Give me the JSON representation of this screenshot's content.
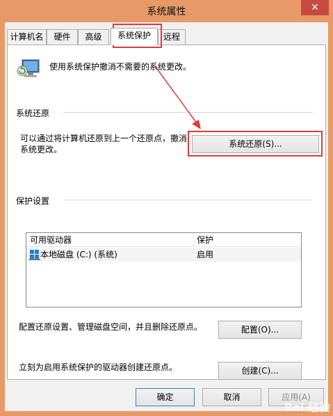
{
  "window": {
    "title": "系统属性",
    "close_label": "✕"
  },
  "tabs": [
    {
      "label": "计算机名"
    },
    {
      "label": "硬件"
    },
    {
      "label": "高级"
    },
    {
      "label": "系统保护"
    },
    {
      "label": "远程"
    }
  ],
  "intro": {
    "text": "使用系统保护撤消不需要的系统更改。"
  },
  "restore": {
    "heading": "系统还原",
    "desc_line1": "可以通过将计算机还原到上一个还原点，撤消",
    "desc_line2": "系统更改。",
    "button": "系统还原(S)..."
  },
  "protection": {
    "heading": "保护设置",
    "columns": [
      "可用驱动器",
      "保护"
    ],
    "rows": [
      {
        "drive": "本地磁盘 (C:) (系统)",
        "status": "启用"
      }
    ],
    "configure_text": "配置还原设置、管理磁盘空间，并且删除还原点。",
    "configure_button": "配置(O)...",
    "create_text": "立刻为启用系统保护的驱动器创建还原点。",
    "create_button": "创建(C)..."
  },
  "footer": {
    "ok": "确定",
    "cancel": "取消",
    "apply": "应用(A)"
  },
  "watermark": "Bai 经验",
  "colors": {
    "titlebar": "#e79a68",
    "close": "#c74a3f",
    "highlight": "#e0383b"
  }
}
